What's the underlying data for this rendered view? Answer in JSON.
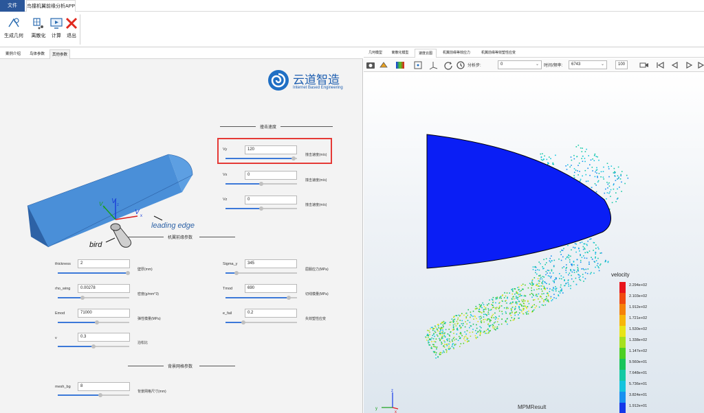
{
  "menubar": {
    "file": "文件",
    "app_tab": "鸟撞机翼前缘分析APP"
  },
  "ribbon": {
    "buttons": [
      {
        "label": "生成几何",
        "icon": "geometry-icon"
      },
      {
        "label": "离散化",
        "icon": "mesh-icon"
      },
      {
        "label": "计算",
        "icon": "compute-icon"
      },
      {
        "label": "退出",
        "icon": "exit-icon"
      }
    ]
  },
  "left_tabs": [
    "案例介绍",
    "鸟体参数",
    "其他参数"
  ],
  "left_active_tab": 2,
  "logo": {
    "text": "云道智造",
    "subtitle": "Internet Based Engineering"
  },
  "diagram": {
    "vy": "V",
    "vy_sub": "y",
    "vx": "V",
    "vx_sub": "x",
    "vz": "V",
    "vz_sub": "z",
    "leading_edge": "leading edge",
    "bird": "bird"
  },
  "impact_velocity": {
    "title": "撞击速度",
    "fields": [
      {
        "label": "Vy",
        "value": "120",
        "unit": "撞击速度(m/s)",
        "level": 0.95
      },
      {
        "label": "Vx",
        "value": "0",
        "unit": "撞击速度(m/s)",
        "level": 0.5
      },
      {
        "label": "Vz",
        "value": "0",
        "unit": "撞击速度(m/s)",
        "level": 0.5
      }
    ]
  },
  "wing_params": {
    "title": "机翼前缘参数",
    "left_fields": [
      {
        "label": "thickness",
        "value": "2",
        "unit": "壁厚(mm)",
        "level": 0.98
      },
      {
        "label": "rho_wing",
        "value": "0.00278",
        "unit": "密度(g/mm^3)",
        "level": 0.35
      },
      {
        "label": "Emod",
        "value": "71000",
        "unit": "弹性模量(MPa)",
        "level": 0.55
      },
      {
        "label": "v",
        "value": "0.3",
        "unit": "泊松比",
        "level": 0.5
      }
    ],
    "right_fields": [
      {
        "label": "Sigma_y",
        "value": "345",
        "unit": "屈服应力(MPa)",
        "level": 0.15
      },
      {
        "label": "Tmod",
        "value": "690",
        "unit": "切线模量(MPa)",
        "level": 0.88
      },
      {
        "label": "e_fail",
        "value": "0.2",
        "unit": "失效塑性应变",
        "level": 0.25
      }
    ]
  },
  "mesh_params": {
    "title": "背景网格参数",
    "fields": [
      {
        "label": "mesh_bg",
        "value": "8",
        "unit": "背景网格尺寸(mm)",
        "level": 0.6
      }
    ]
  },
  "right_tabs": [
    "几何模型",
    "离散化模型",
    "速度云图",
    "机翼前缘等效应力",
    "机翼前缘等效塑性应变"
  ],
  "right_active_tab": 2,
  "toolbar": {
    "step_label": "分析步:",
    "step_value": "0",
    "time_label": "时间/频率:",
    "time_value": "6743",
    "zoom_value": "100"
  },
  "legend": {
    "title": "velocity",
    "labels": [
      "2.294e+02",
      "2.103e+02",
      "1.912e+02",
      "1.721e+02",
      "1.530e+02",
      "1.338e+02",
      "1.147e+02",
      "9.560e+01",
      "7.648e+01",
      "5.736e+01",
      "3.824e+01",
      "1.912e+01"
    ],
    "colors": [
      "#e8141b",
      "#f04a10",
      "#f5820a",
      "#f7b60a",
      "#e8e418",
      "#a6e01e",
      "#4ccf22",
      "#18c45a",
      "#14c9a4",
      "#14c4de",
      "#1890f0",
      "#1438e8"
    ]
  },
  "result_label": "MPMResult",
  "axes": {
    "x": "x",
    "y": "y",
    "z": "z"
  },
  "colors": {
    "accent": "#2b579a",
    "highlight": "#e53935",
    "wing_blue": "#0a1ef5",
    "wing_model": "#4a8fd8"
  }
}
